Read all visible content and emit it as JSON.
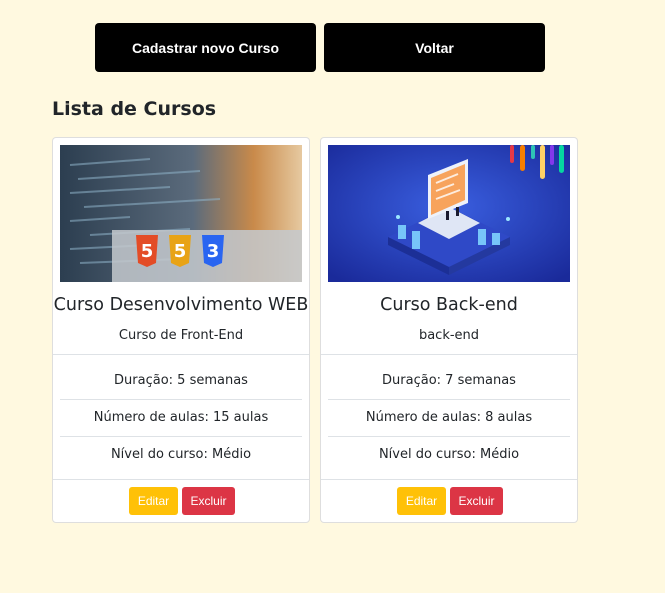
{
  "header": {
    "new_course_label": "Cadastrar novo Curso",
    "back_label": "Voltar"
  },
  "list_title": "Lista de Cursos",
  "courses": [
    {
      "title": "Curso Desenvolvimento WEB",
      "subtitle": "Curso de Front-End",
      "duration": "Duração: 5 semanas",
      "lessons": "Número de aulas: 15 aulas",
      "level": "Nível do curso: Médio",
      "edit_label": "Editar",
      "delete_label": "Excluir",
      "image": {
        "kind": "html5-css3-js-logos-photo",
        "badges": [
          "HTML",
          "JS",
          "CSS"
        ]
      }
    },
    {
      "title": "Curso Back-end",
      "subtitle": "back-end",
      "duration": "Duração: 7 semanas",
      "lessons": "Número de aulas: 8 aulas",
      "level": "Nível do curso: Médio",
      "edit_label": "Editar",
      "delete_label": "Excluir",
      "image": {
        "kind": "isometric-server-laptop-illustration"
      }
    }
  ],
  "colors": {
    "page_background": "#fff9e0",
    "primary_button": "#000000",
    "edit_button": "#ffc107",
    "delete_button": "#dc3545"
  }
}
